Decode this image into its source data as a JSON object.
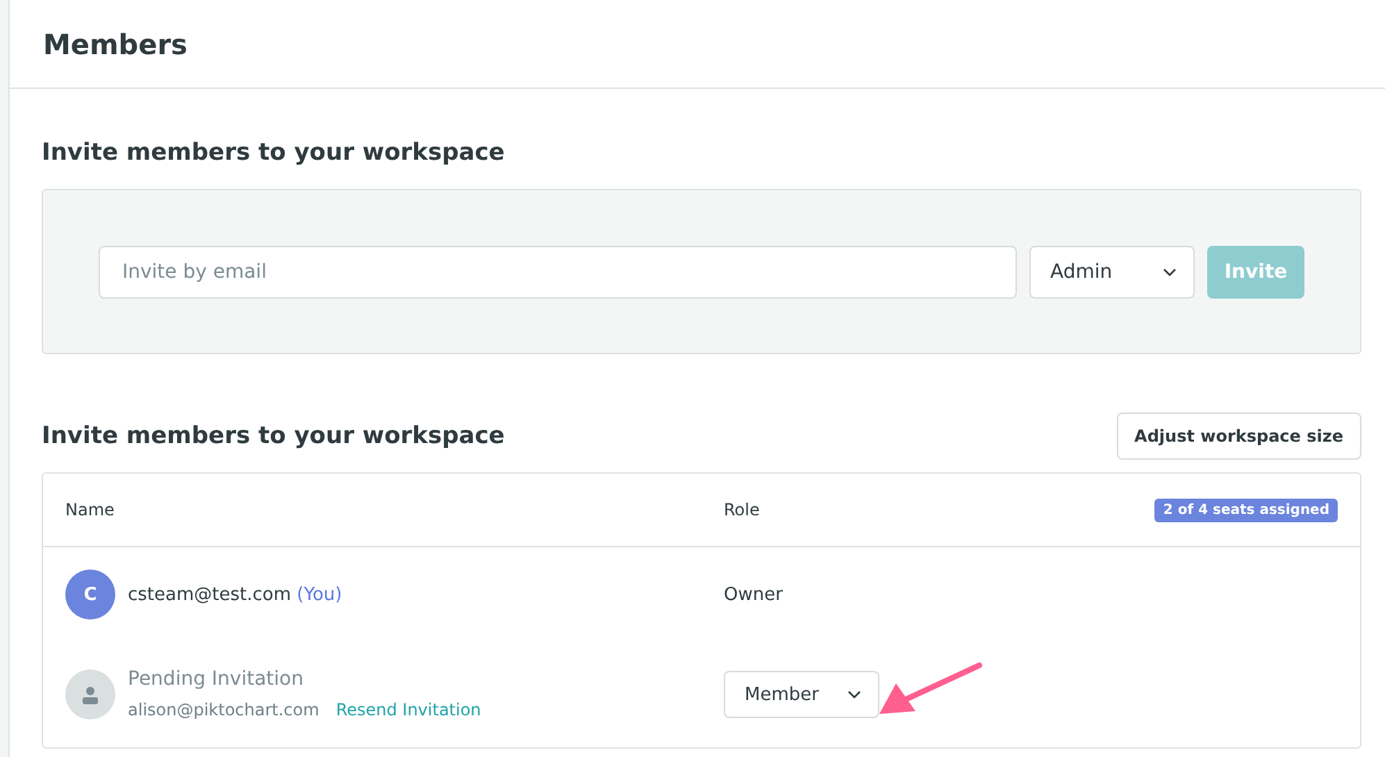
{
  "page_title": "Members",
  "invite": {
    "heading": "Invite members to your workspace",
    "email_placeholder": "Invite by email",
    "role": "Admin",
    "button": "Invite",
    "button_disabled": true
  },
  "members_section": {
    "heading": "Invite members to your workspace",
    "adjust_button": "Adjust workspace size",
    "columns": [
      "Name",
      "Role"
    ],
    "seats_badge": "2 of 4 seats assigned",
    "rows": [
      {
        "kind": "member",
        "initial": "C",
        "email": "csteam@test.com",
        "you_tag": "(You)",
        "role": {
          "kind": "text",
          "label": "Owner"
        }
      },
      {
        "kind": "pending",
        "status": "Pending Invitation",
        "email": "alison@piktochart.com",
        "resend": "Resend Invitation",
        "role": {
          "kind": "dropdown",
          "label": "Member"
        }
      }
    ]
  },
  "annotation": {
    "kind": "arrow"
  }
}
